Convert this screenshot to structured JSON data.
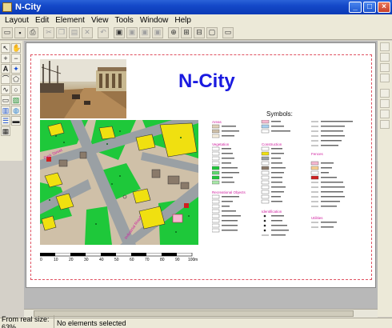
{
  "window": {
    "title": "N-City"
  },
  "menu": [
    "Layout",
    "Edit",
    "Element",
    "View",
    "Tools",
    "Window",
    "Help"
  ],
  "map": {
    "title": "N-City",
    "street_labels": [
      "Park Street",
      "Industrial Road"
    ],
    "scale_ticks": [
      "0",
      "10",
      "20",
      "30",
      "40",
      "50",
      "60",
      "70",
      "80",
      "90",
      "100",
      "m"
    ]
  },
  "legend": {
    "title": "Symbols:",
    "headings": [
      "Areas",
      "Vegetation",
      "Recreational Objects",
      "Construction",
      "Identification",
      "Fences",
      "Utilities"
    ],
    "colors": {
      "vegetation": "#1ec83a",
      "building": "#f0e010",
      "ground": "#cfc0a8",
      "street": "#9aa0a4",
      "heading": "#d020a0"
    }
  },
  "status": {
    "zoom": "From real size: 63%",
    "selection": "No elements selected"
  }
}
